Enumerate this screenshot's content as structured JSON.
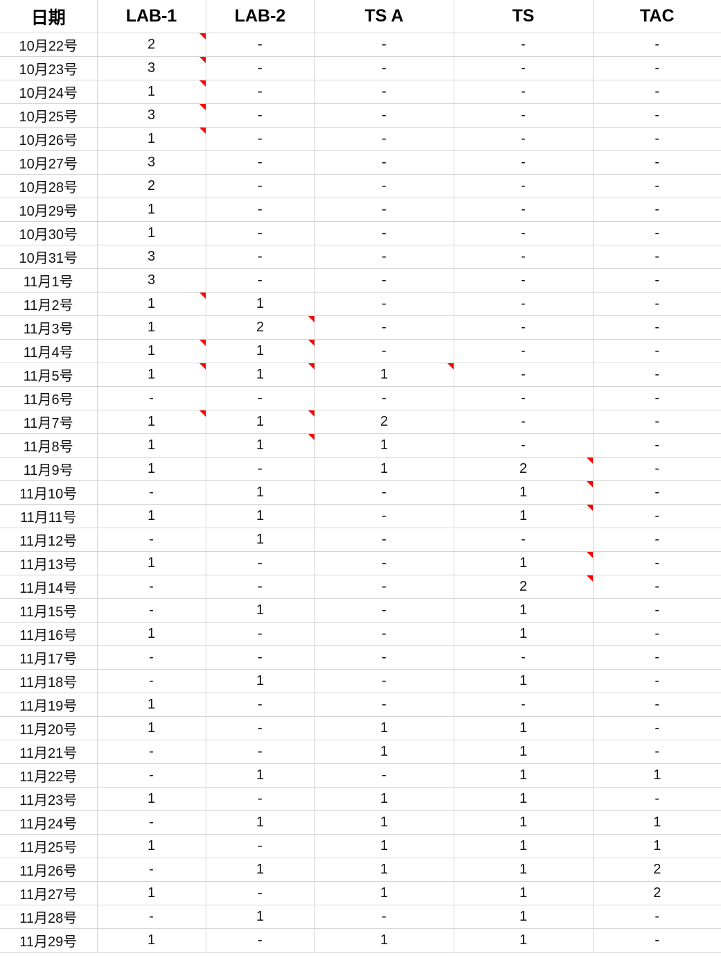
{
  "columns": [
    "日期",
    "LAB-1",
    "LAB-2",
    "TS A",
    "TS",
    "TAC"
  ],
  "comment_color": "#ff0000",
  "rows": [
    {
      "date": "10月22号",
      "values": [
        "2",
        "-",
        "-",
        "-",
        "-"
      ],
      "comments": [
        "LAB-1"
      ]
    },
    {
      "date": "10月23号",
      "values": [
        "3",
        "-",
        "-",
        "-",
        "-"
      ],
      "comments": [
        "LAB-1"
      ]
    },
    {
      "date": "10月24号",
      "values": [
        "1",
        "-",
        "-",
        "-",
        "-"
      ],
      "comments": [
        "LAB-1"
      ]
    },
    {
      "date": "10月25号",
      "values": [
        "3",
        "-",
        "-",
        "-",
        "-"
      ],
      "comments": [
        "LAB-1"
      ]
    },
    {
      "date": "10月26号",
      "values": [
        "1",
        "-",
        "-",
        "-",
        "-"
      ],
      "comments": [
        "LAB-1"
      ]
    },
    {
      "date": "10月27号",
      "values": [
        "3",
        "-",
        "-",
        "-",
        "-"
      ],
      "comments": []
    },
    {
      "date": "10月28号",
      "values": [
        "2",
        "-",
        "-",
        "-",
        "-"
      ],
      "comments": []
    },
    {
      "date": "10月29号",
      "values": [
        "1",
        "-",
        "-",
        "-",
        "-"
      ],
      "comments": []
    },
    {
      "date": "10月30号",
      "values": [
        "1",
        "-",
        "-",
        "-",
        "-"
      ],
      "comments": []
    },
    {
      "date": "10月31号",
      "values": [
        "3",
        "-",
        "-",
        "-",
        "-"
      ],
      "comments": []
    },
    {
      "date": "11月1号",
      "values": [
        "3",
        "-",
        "-",
        "-",
        "-"
      ],
      "comments": []
    },
    {
      "date": "11月2号",
      "values": [
        "1",
        "1",
        "-",
        "-",
        "-"
      ],
      "comments": [
        "LAB-1"
      ]
    },
    {
      "date": "11月3号",
      "values": [
        "1",
        "2",
        "-",
        "-",
        "-"
      ],
      "comments": [
        "LAB-2"
      ]
    },
    {
      "date": "11月4号",
      "values": [
        "1",
        "1",
        "-",
        "-",
        "-"
      ],
      "comments": [
        "LAB-1",
        "LAB-2"
      ]
    },
    {
      "date": "11月5号",
      "values": [
        "1",
        "1",
        "1",
        "-",
        "-"
      ],
      "comments": [
        "LAB-1",
        "LAB-2",
        "TS A"
      ]
    },
    {
      "date": "11月6号",
      "values": [
        "-",
        "-",
        "-",
        "-",
        "-"
      ],
      "comments": []
    },
    {
      "date": "11月7号",
      "values": [
        "1",
        "1",
        "2",
        "-",
        "-"
      ],
      "comments": [
        "LAB-1",
        "LAB-2"
      ]
    },
    {
      "date": "11月8号",
      "values": [
        "1",
        "1",
        "1",
        "-",
        "-"
      ],
      "comments": [
        "LAB-2"
      ]
    },
    {
      "date": "11月9号",
      "values": [
        "1",
        "-",
        "1",
        "2",
        "-"
      ],
      "comments": [
        "TS"
      ]
    },
    {
      "date": "11月10号",
      "values": [
        "-",
        "1",
        "-",
        "1",
        "-"
      ],
      "comments": [
        "TS"
      ]
    },
    {
      "date": "11月11号",
      "values": [
        "1",
        "1",
        "-",
        "1",
        "-"
      ],
      "comments": [
        "TS"
      ]
    },
    {
      "date": "11月12号",
      "values": [
        "-",
        "1",
        "-",
        "-",
        "-"
      ],
      "comments": []
    },
    {
      "date": "11月13号",
      "values": [
        "1",
        "-",
        "-",
        "1",
        "-"
      ],
      "comments": [
        "TS"
      ]
    },
    {
      "date": "11月14号",
      "values": [
        "-",
        "-",
        "-",
        "2",
        "-"
      ],
      "comments": [
        "TS"
      ]
    },
    {
      "date": "11月15号",
      "values": [
        "-",
        "1",
        "-",
        "1",
        "-"
      ],
      "comments": []
    },
    {
      "date": "11月16号",
      "values": [
        "1",
        "-",
        "-",
        "1",
        "-"
      ],
      "comments": []
    },
    {
      "date": "11月17号",
      "values": [
        "-",
        "-",
        "-",
        "-",
        "-"
      ],
      "comments": []
    },
    {
      "date": "11月18号",
      "values": [
        "-",
        "1",
        "-",
        "1",
        "-"
      ],
      "comments": []
    },
    {
      "date": "11月19号",
      "values": [
        "1",
        "-",
        "-",
        "-",
        "-"
      ],
      "comments": []
    },
    {
      "date": "11月20号",
      "values": [
        "1",
        "-",
        "1",
        "1",
        "-"
      ],
      "comments": []
    },
    {
      "date": "11月21号",
      "values": [
        "-",
        "-",
        "1",
        "1",
        "-"
      ],
      "comments": []
    },
    {
      "date": "11月22号",
      "values": [
        "-",
        "1",
        "-",
        "1",
        "1"
      ],
      "comments": []
    },
    {
      "date": "11月23号",
      "values": [
        "1",
        "-",
        "1",
        "1",
        "-"
      ],
      "comments": []
    },
    {
      "date": "11月24号",
      "values": [
        "-",
        "1",
        "1",
        "1",
        "1"
      ],
      "comments": []
    },
    {
      "date": "11月25号",
      "values": [
        "1",
        "-",
        "1",
        "1",
        "1"
      ],
      "comments": []
    },
    {
      "date": "11月26号",
      "values": [
        "-",
        "1",
        "1",
        "1",
        "2"
      ],
      "comments": []
    },
    {
      "date": "11月27号",
      "values": [
        "1",
        "-",
        "1",
        "1",
        "2"
      ],
      "comments": []
    },
    {
      "date": "11月28号",
      "values": [
        "-",
        "1",
        "-",
        "1",
        "-"
      ],
      "comments": []
    },
    {
      "date": "11月29号",
      "values": [
        "1",
        "-",
        "1",
        "1",
        "-"
      ],
      "comments": []
    }
  ]
}
